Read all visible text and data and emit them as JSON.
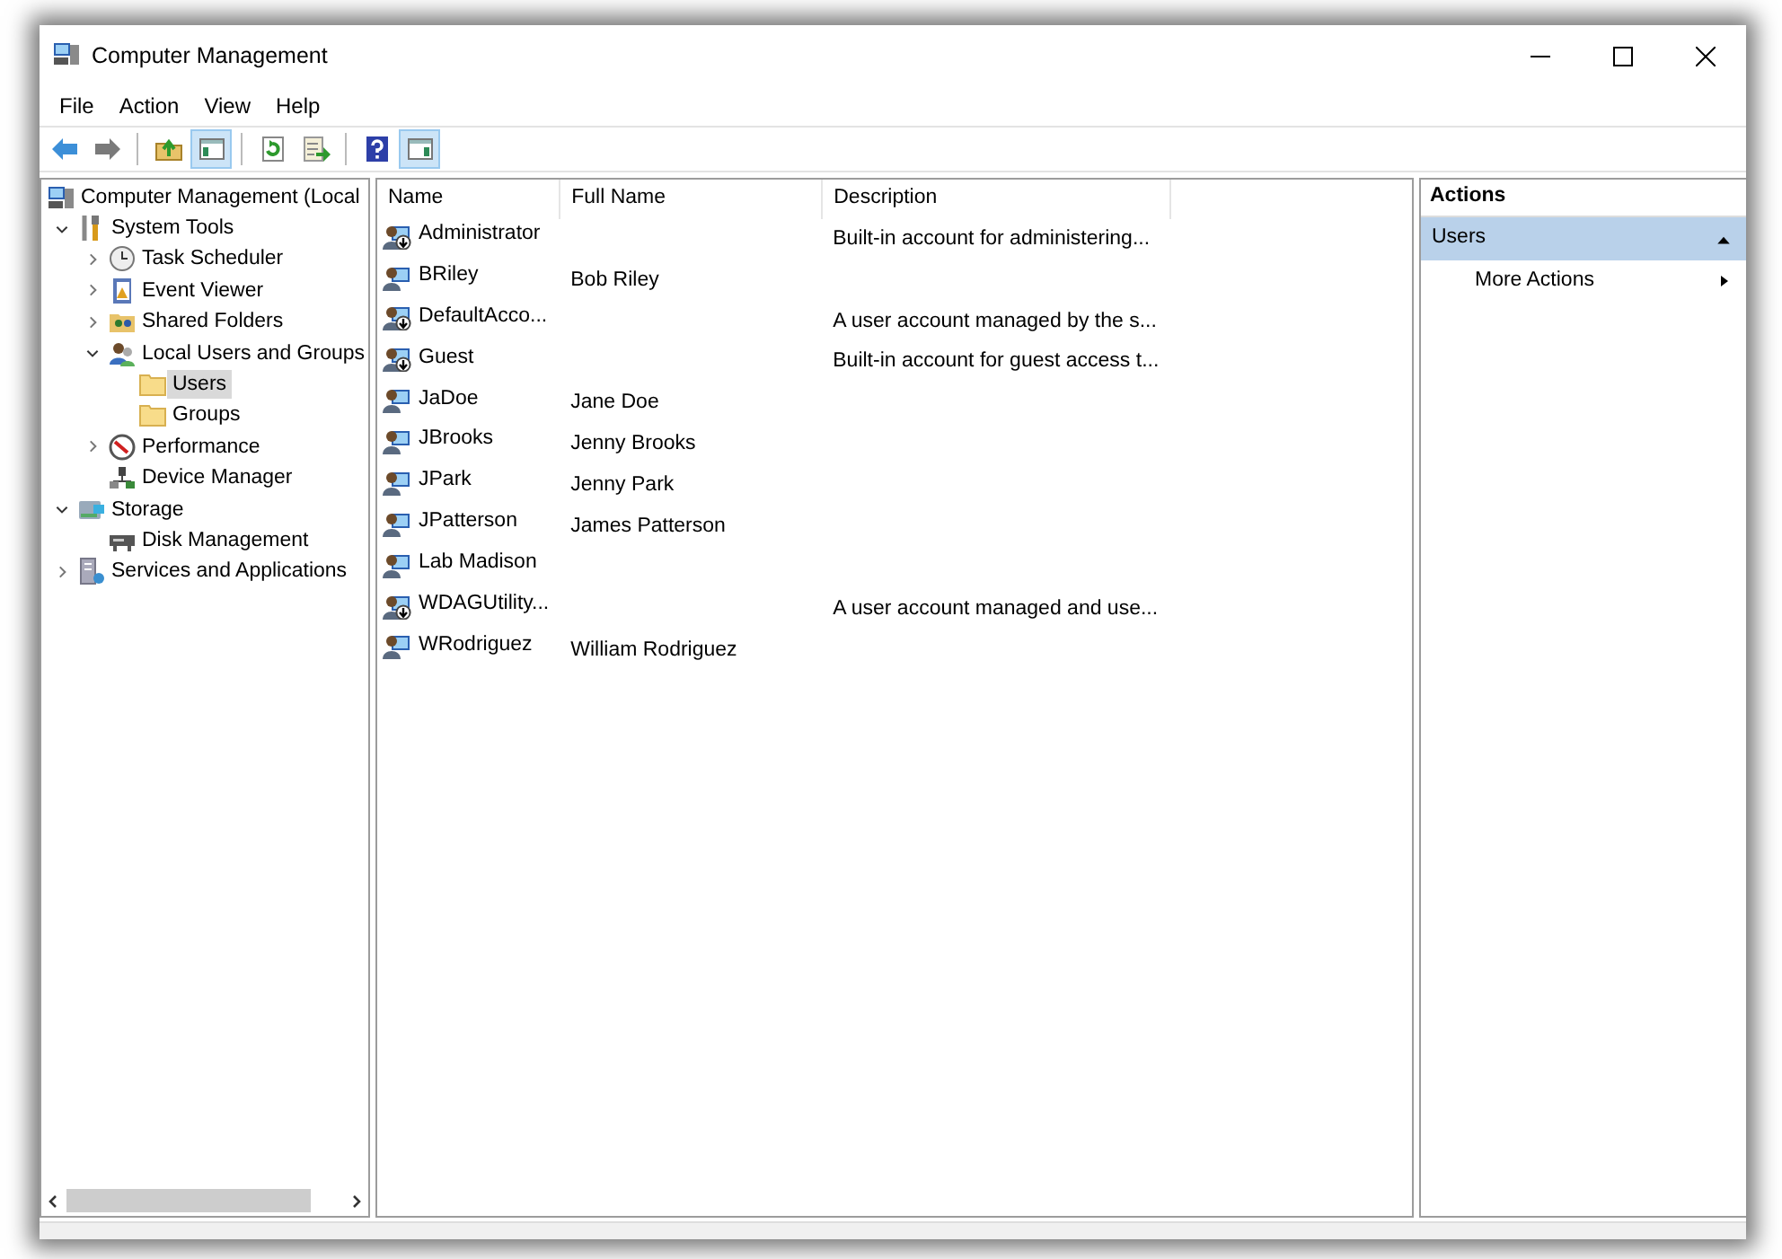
{
  "window": {
    "title": "Computer Management"
  },
  "menu": [
    "File",
    "Action",
    "View",
    "Help"
  ],
  "toolbar": [
    {
      "kind": "back",
      "pressed": false
    },
    {
      "kind": "forward",
      "pressed": false
    },
    {
      "kind": "separator"
    },
    {
      "kind": "up",
      "pressed": false
    },
    {
      "kind": "tree-pane",
      "pressed": true
    },
    {
      "kind": "separator"
    },
    {
      "kind": "refresh",
      "pressed": false
    },
    {
      "kind": "export",
      "pressed": false
    },
    {
      "kind": "separator"
    },
    {
      "kind": "help",
      "pressed": false
    },
    {
      "kind": "action-pane",
      "pressed": true
    }
  ],
  "tree": [
    {
      "label": "Computer Management (Local",
      "kind": "computer",
      "selected": false,
      "children": [
        {
          "label": "System Tools",
          "kind": "tools",
          "expanded": true,
          "selected": false,
          "children": [
            {
              "label": "Task Scheduler",
              "kind": "clock",
              "expanded": false,
              "selected": false
            },
            {
              "label": "Event Viewer",
              "kind": "log",
              "expanded": false,
              "selected": false
            },
            {
              "label": "Shared Folders",
              "kind": "share",
              "expanded": false,
              "selected": false
            },
            {
              "label": "Local Users and Groups",
              "kind": "users",
              "expanded": true,
              "selected": false,
              "children": [
                {
                  "label": "Users",
                  "kind": "folder",
                  "selected": true
                },
                {
                  "label": "Groups",
                  "kind": "folder",
                  "selected": false
                }
              ]
            },
            {
              "label": "Performance",
              "kind": "gauge",
              "expanded": false,
              "selected": false
            },
            {
              "label": "Device Manager",
              "kind": "device",
              "selected": false
            }
          ]
        },
        {
          "label": "Storage",
          "kind": "storage",
          "expanded": true,
          "selected": false,
          "children": [
            {
              "label": "Disk Management",
              "kind": "disk",
              "selected": false
            }
          ]
        },
        {
          "label": "Services and Applications",
          "kind": "services",
          "expanded": false,
          "selected": false
        }
      ]
    }
  ],
  "table": {
    "columns": [
      "Name",
      "Full Name",
      "Description"
    ],
    "rows": [
      {
        "name": "Administrator",
        "full_name": "",
        "description": "Built-in account for administering...",
        "disabled": true
      },
      {
        "name": "BRiley",
        "full_name": "Bob Riley",
        "description": "",
        "disabled": false
      },
      {
        "name": "DefaultAcco...",
        "full_name": "",
        "description": "A user account managed by the s...",
        "disabled": true
      },
      {
        "name": "Guest",
        "full_name": "",
        "description": "Built-in account for guest access t...",
        "disabled": true
      },
      {
        "name": "JaDoe",
        "full_name": "Jane Doe",
        "description": "",
        "disabled": false
      },
      {
        "name": "JBrooks",
        "full_name": "Jenny Brooks",
        "description": "",
        "disabled": false
      },
      {
        "name": "JPark",
        "full_name": "Jenny Park",
        "description": "",
        "disabled": false
      },
      {
        "name": "JPatterson",
        "full_name": "James Patterson",
        "description": "",
        "disabled": false
      },
      {
        "name": "Lab Madison",
        "full_name": "",
        "description": "",
        "disabled": false
      },
      {
        "name": "WDAGUtility...",
        "full_name": "",
        "description": "A user account managed and use...",
        "disabled": true
      },
      {
        "name": "WRodriguez",
        "full_name": "William Rodriguez",
        "description": "",
        "disabled": false
      }
    ]
  },
  "actions": {
    "title": "Actions",
    "sections": [
      {
        "label": "Users",
        "expanded": true,
        "items": [
          {
            "label": "More Actions",
            "submenu": true
          }
        ]
      }
    ]
  }
}
